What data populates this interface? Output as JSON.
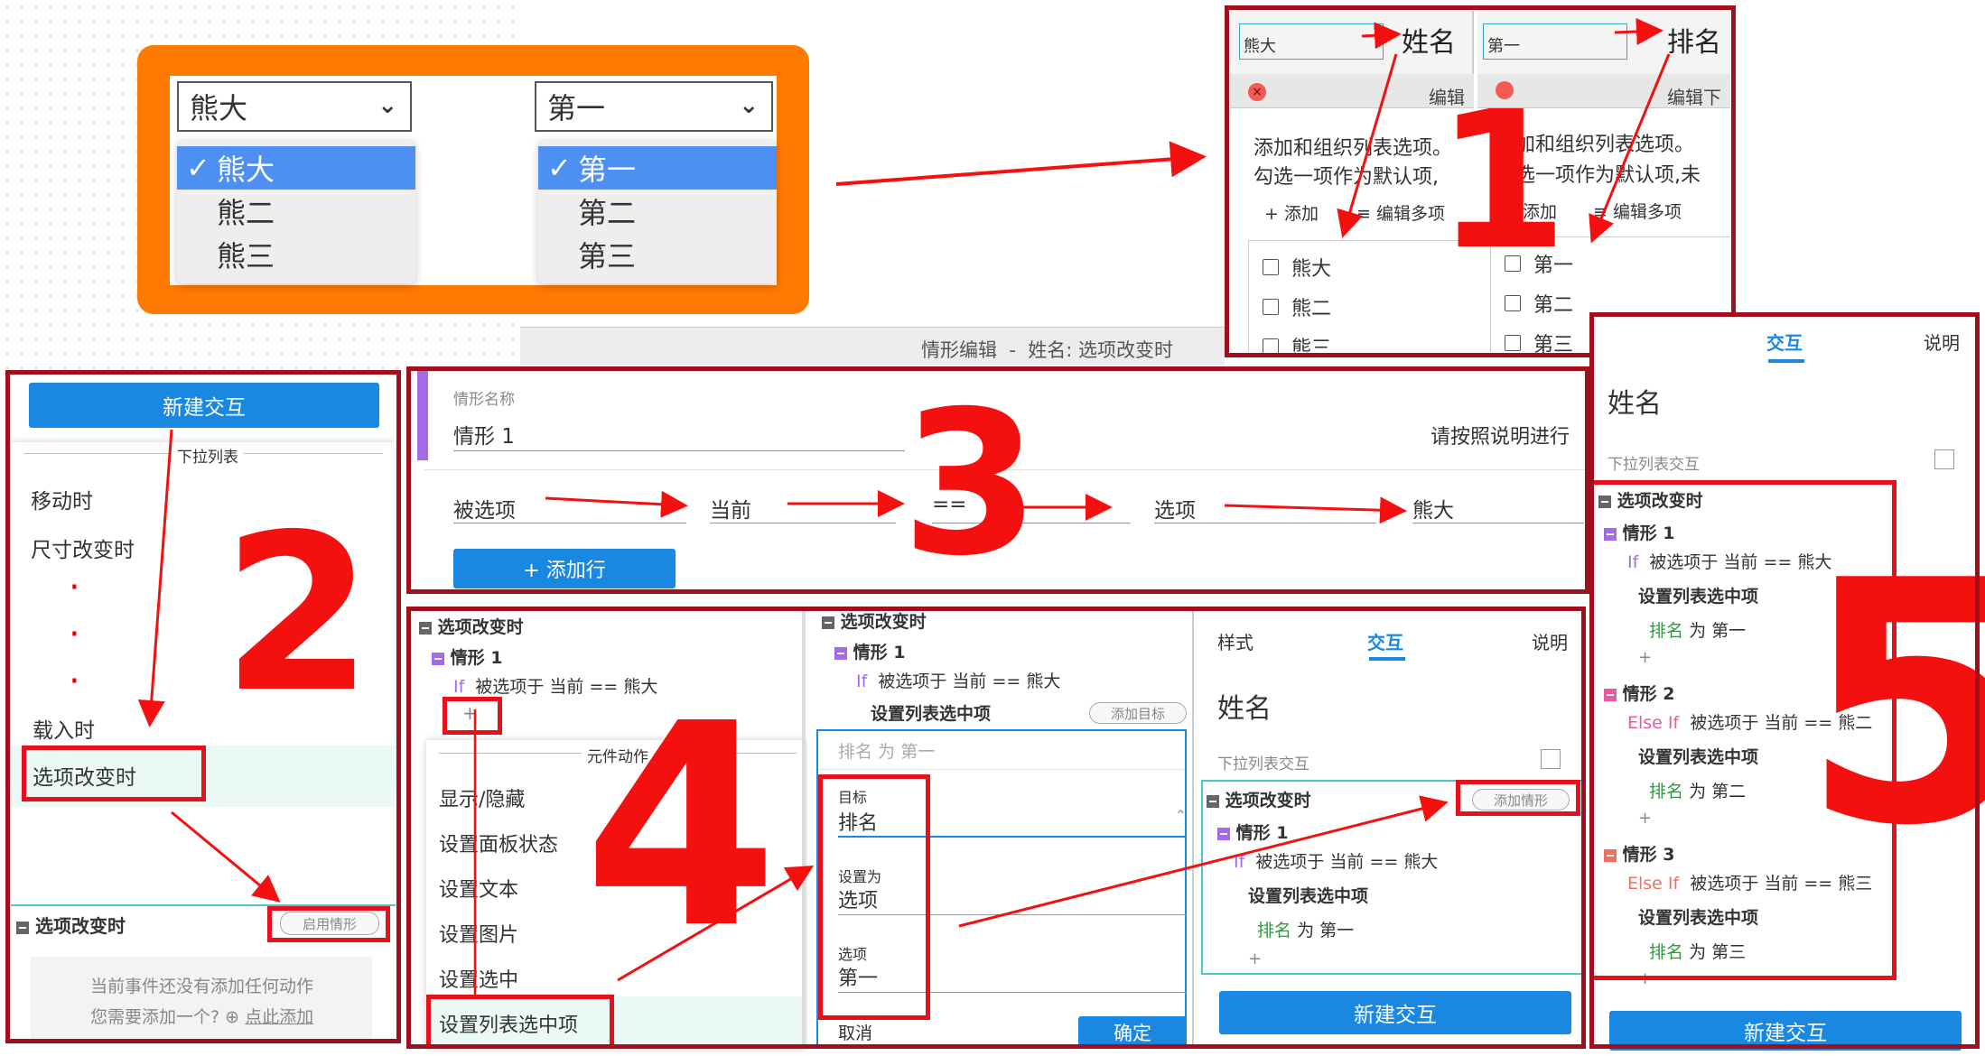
{
  "demo": {
    "dropdown1": {
      "value": "熊大",
      "options": [
        "熊大",
        "熊二",
        "熊三"
      ],
      "check": "✓"
    },
    "dropdown2": {
      "value": "第一",
      "options": [
        "第一",
        "第二",
        "第三"
      ],
      "check": "✓"
    }
  },
  "panel1": {
    "number": "1",
    "left": {
      "widget": "熊大",
      "name": "姓名",
      "edit": "编辑",
      "desc1": "添加和组织列表选项。",
      "desc2": "勾选一项作为默认项,",
      "add": "添加",
      "edit_multi": "编辑多项",
      "options": [
        "熊大",
        "熊二",
        "熊三"
      ]
    },
    "right": {
      "widget": "第一",
      "name": "排名",
      "edit": "编辑下",
      "desc1": "添加和组织列表选项。",
      "desc2": "勾选一项作为默认项,未",
      "add": "添加",
      "edit_multi": "编辑多项",
      "options": [
        "第一",
        "第二",
        "第三"
      ]
    }
  },
  "panel2": {
    "number": "2",
    "new_btn": "新建交互",
    "group": "下拉列表",
    "items": [
      "移动时",
      "尺寸改变时",
      "载入时",
      "选项改变时"
    ],
    "dots": [
      "·",
      "·",
      "·"
    ],
    "section": "选项改变时",
    "enable_btn": "启用情形",
    "empty1": "当前事件还没有添加任何动作",
    "empty2": "您需要添加一个?",
    "empty_link": "点此添加"
  },
  "panel3": {
    "number": "3",
    "header": "情形编辑  -  姓名: 选项改变时",
    "label": "情形名称",
    "name": "情形 1",
    "hint": "请按照说明进行",
    "cond": [
      "被选项",
      "当前",
      "==",
      "选项",
      "熊大"
    ],
    "add_row": "+ 添加行"
  },
  "panel4": {
    "number": "4",
    "col1": {
      "event": "选项改变时",
      "case": "情形 1",
      "if": "If",
      "cond": "被选项于 当前 == 熊大",
      "plus": "+",
      "group": "元件动作",
      "actions": [
        "显示/隐藏",
        "设置面板状态",
        "设置文本",
        "设置图片",
        "设置选中",
        "设置列表选中项"
      ]
    },
    "col2": {
      "event": "选项改变时",
      "case": "情形 1",
      "if": "If",
      "cond": "被选项于 当前 == 熊大",
      "action": "设置列表选中项",
      "add_target": "添加目标",
      "summary": "排名 为 第一",
      "target_label": "目标",
      "target": "排名",
      "setas_label": "设置为",
      "setas": "选项",
      "option_label": "选项",
      "option": "第一",
      "cancel": "取消",
      "ok": "确定"
    },
    "col3": {
      "tabs": [
        "样式",
        "交互",
        "说明"
      ],
      "title": "姓名",
      "sub": "下拉列表交互",
      "event": "选项改变时",
      "add_case": "添加情形",
      "case": "情形 1",
      "if": "If",
      "cond": "被选项于 当前 == 熊大",
      "action": "设置列表选中项",
      "target": "排名",
      "rest": "为 第一",
      "plus": "+",
      "new_btn": "新建交互"
    }
  },
  "panel5": {
    "number": "5",
    "tabs": [
      "交互",
      "说明"
    ],
    "title": "姓名",
    "sub": "下拉列表交互",
    "event": "选项改变时",
    "cases": [
      {
        "name": "情形 1",
        "kw": "If",
        "cond": "被选项于 当前 == 熊大",
        "action": "设置列表选中项",
        "target": "排名",
        "rest": "为 第一",
        "color": "#a46be8"
      },
      {
        "name": "情形 2",
        "kw": "Else If",
        "cond": "被选项于 当前 == 熊二",
        "action": "设置列表选中项",
        "target": "排名",
        "rest": "为 第二",
        "color": "#e85aa0"
      },
      {
        "name": "情形 3",
        "kw": "Else If",
        "cond": "被选项于 当前 == 熊三",
        "action": "设置列表选中项",
        "target": "排名",
        "rest": "为 第三",
        "color": "#f07060"
      }
    ],
    "plus": "+",
    "new_btn": "新建交互"
  }
}
